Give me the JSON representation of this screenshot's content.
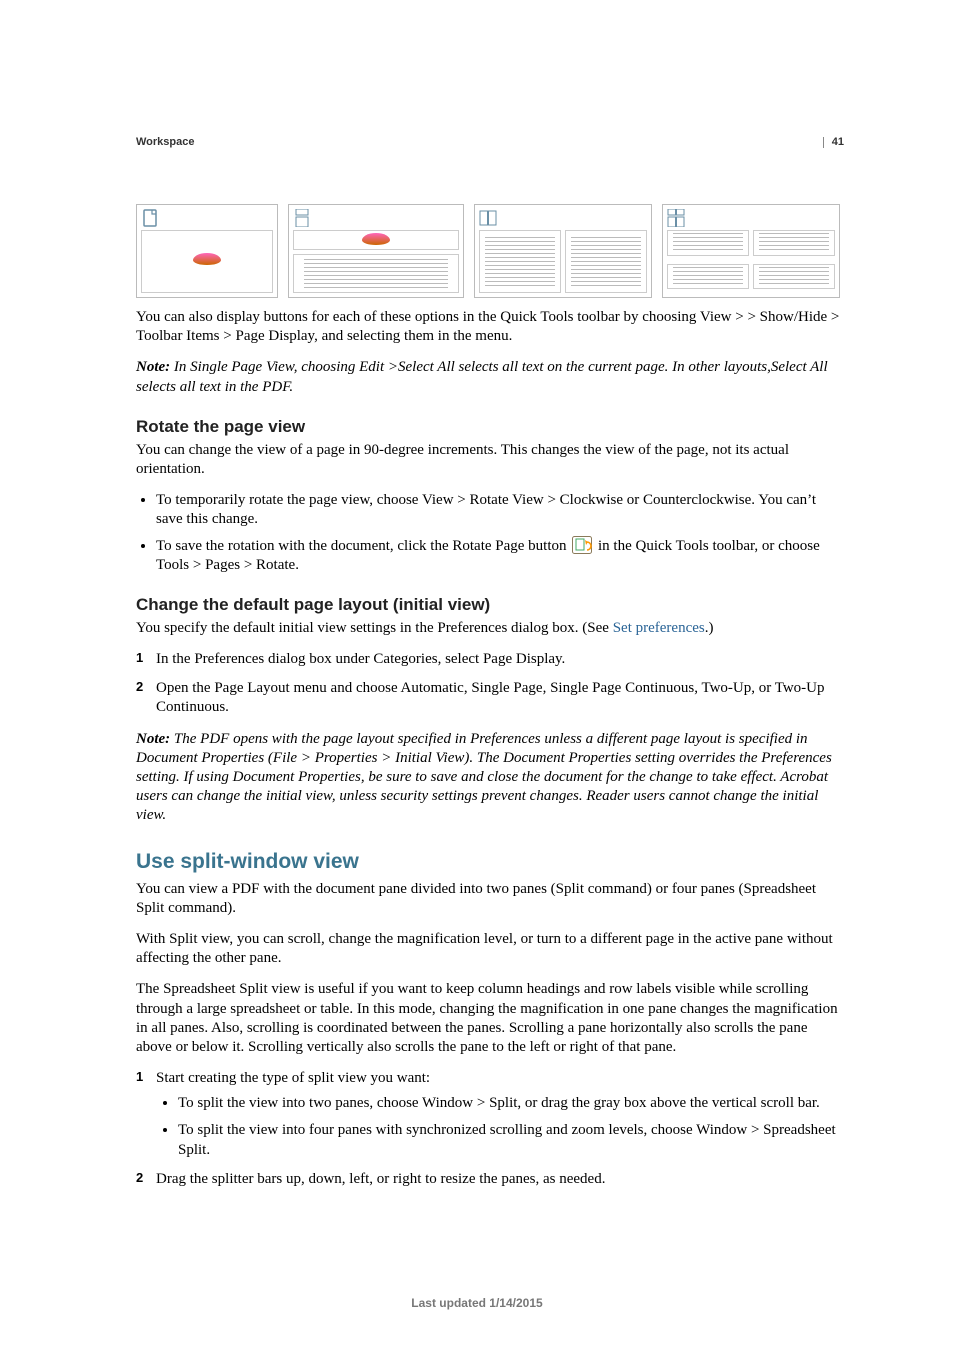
{
  "header": {
    "breadcrumb": "Workspace",
    "page_number": "41"
  },
  "intro_text": "You can also display buttons for each of these options in the Quick Tools toolbar by choosing View > > Show/Hide > Toolbar Items > Page Display, and selecting them in the menu.",
  "note1": {
    "label": "Note: ",
    "body": "In Single Page View, choosing Edit >Select All selects all text on the current page. In other layouts,Select All selects all text in the PDF."
  },
  "rotate": {
    "heading": "Rotate the page view",
    "intro": "You can change the view of a page in 90-degree increments. This changes the view of the page, not its actual orientation.",
    "bullets": [
      "To temporarily rotate the page view, choose View > Rotate View > Clockwise or Counterclockwise. You can’t save this change.",
      {
        "pre": "To save the rotation with the document, click the Rotate Page button ",
        "post": " in the Quick Tools toolbar, or choose Tools > Pages > Rotate."
      }
    ]
  },
  "layout": {
    "heading": "Change the default page layout (initial view)",
    "intro_pre": "You specify the default initial view settings in the Preferences dialog box. (See ",
    "intro_link": "Set preferences",
    "intro_post": ".)",
    "steps": [
      "In the Preferences dialog box under Categories, select Page Display.",
      "Open the Page Layout menu and choose Automatic, Single Page, Single Page Continuous, Two-Up, or Two-Up Continuous."
    ],
    "note_label": "Note: ",
    "note_body": "The PDF opens with the page layout specified in Preferences unless a different page layout is specified in Document Properties (File > Properties > Initial View). The Document Properties setting overrides the Preferences setting. If using Document Properties, be sure to save and close the document for the change to take effect. Acrobat users can change the initial view, unless security settings prevent changes. Reader users cannot change the initial view."
  },
  "split": {
    "heading": "Use split-window view",
    "p1": "You can view a PDF with the document pane divided into two panes (Split command) or four panes (Spreadsheet Split command).",
    "p2": "With Split view, you can scroll, change the magnification level, or turn to a different page in the active pane without affecting the other pane.",
    "p3": "The Spreadsheet Split view is useful if you want to keep column headings and row labels visible while scrolling through a large spreadsheet or table. In this mode, changing the magnification in one pane changes the magnification in all panes. Also, scrolling is coordinated between the panes. Scrolling a pane horizontally also scrolls the pane above or below it. Scrolling vertically also scrolls the pane to the left or right of that pane.",
    "step1_intro": "Start creating the type of split view you want:",
    "step1_subs": [
      "To split the view into two panes, choose Window > Split, or drag the gray box above the vertical scroll bar.",
      "To split the view into four panes with synchronized scrolling and zoom levels, choose Window > Spreadsheet Split."
    ],
    "step2": "Drag the splitter bars up, down, left, or right to resize the panes, as needed."
  },
  "footer": "Last updated 1/14/2015",
  "icons": {
    "single_page": "single-page-icon",
    "single_page_cont": "single-page-continuous-icon",
    "two_up": "two-up-icon",
    "two_up_cont": "two-up-continuous-icon",
    "rotate_page": "rotate-page-icon"
  }
}
